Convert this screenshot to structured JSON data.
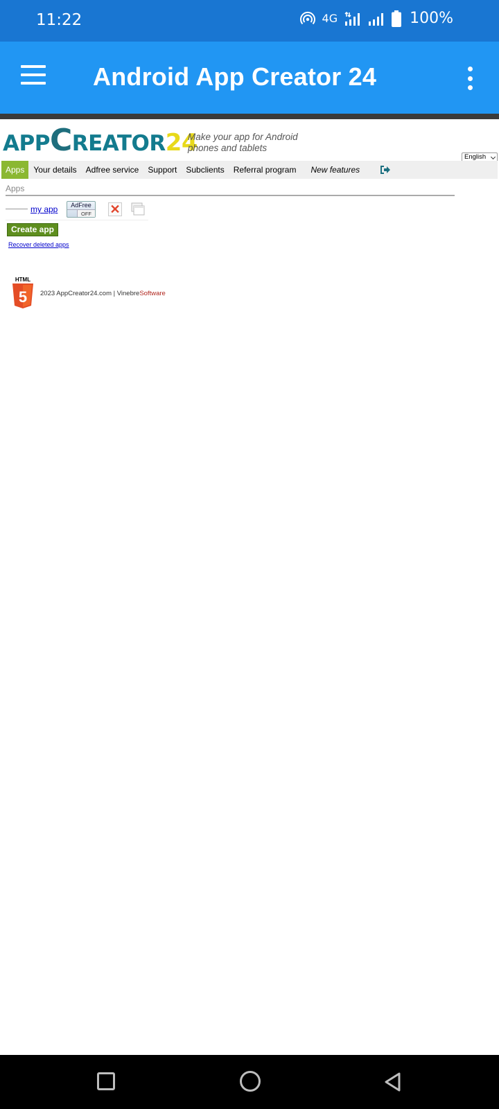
{
  "status_bar": {
    "time": "11:22",
    "network": "4G",
    "battery": "100%"
  },
  "app_bar": {
    "title": "Android App Creator 24"
  },
  "site": {
    "logo_app": "APP",
    "logo_c": "C",
    "logo_reator": "REATOR",
    "logo_num": "24",
    "slogan_line1": "Make your app for Android",
    "slogan_line2": "phones and tablets",
    "language": "English",
    "nav": [
      {
        "label": "Apps",
        "active": true
      },
      {
        "label": "Your details"
      },
      {
        "label": "Adfree service"
      },
      {
        "label": "Support"
      },
      {
        "label": "Subclients"
      },
      {
        "label": "Referral program"
      },
      {
        "label": "New features"
      }
    ],
    "section_title": "Apps",
    "app_item": {
      "name": "my app",
      "adfree_label": "AdFree",
      "adfree_state": "OFF"
    },
    "create_button": "Create app",
    "recover_link": "Recover deleted apps",
    "footer": {
      "html5_label": "HTML",
      "html5_num": "5",
      "copyright": "2023 AppCreator24.com | ",
      "brand_part1": "Vinebre",
      "brand_part2": "Software"
    }
  },
  "colors": {
    "status_bar": "#1976d2",
    "app_bar": "#2196f3",
    "nav_active": "#8bb832",
    "create_button": "#5e8e1e"
  }
}
